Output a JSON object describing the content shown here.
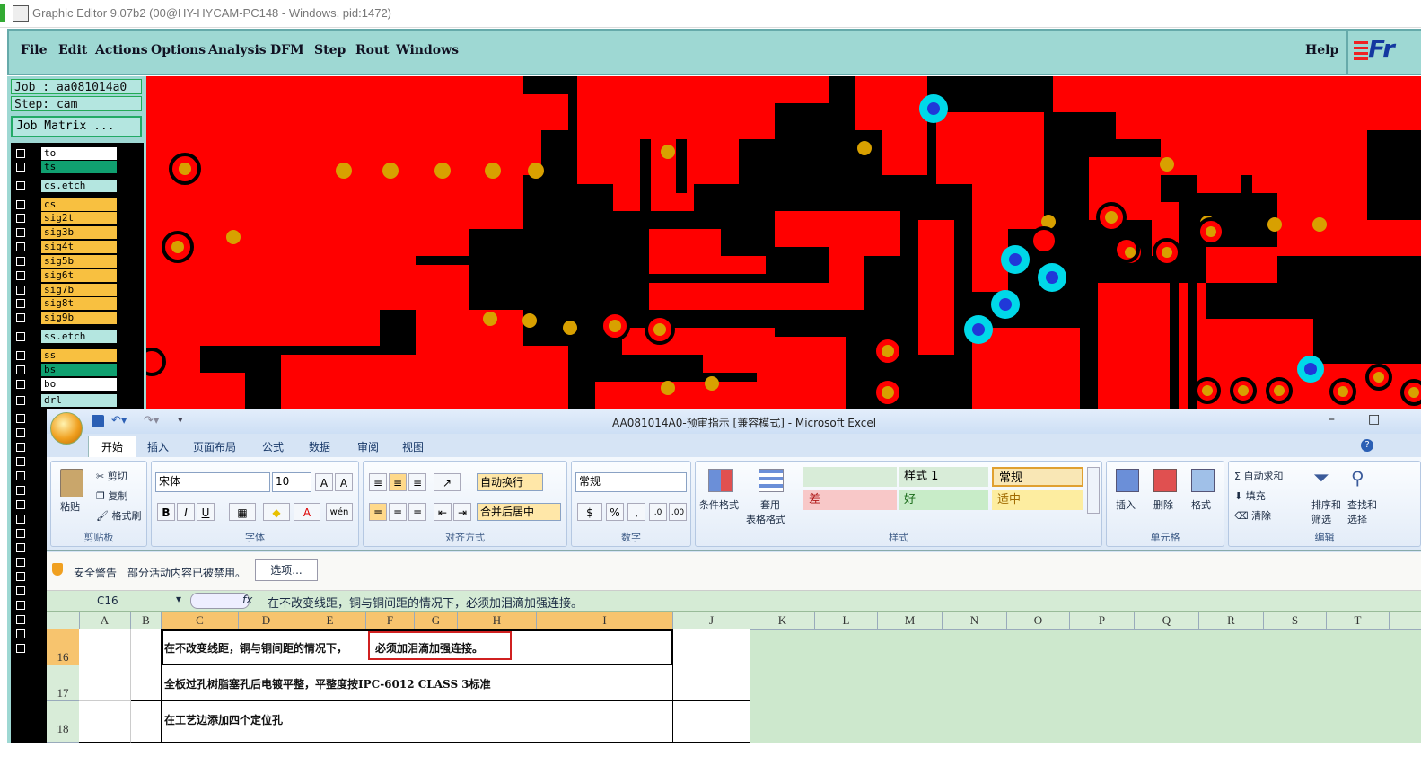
{
  "window": {
    "title": "Graphic Editor 9.07b2 (00@HY-HYCAM-PC148 - Windows, pid:1472)"
  },
  "menu": {
    "items": [
      "File",
      "Edit",
      "Actions",
      "Options",
      "Analysis",
      "DFM",
      "Step",
      "Rout",
      "Windows"
    ],
    "help": "Help",
    "logo": "Fr"
  },
  "panel": {
    "job": "Job : aa081014a0",
    "step": "Step: cam",
    "job_matrix": "Job Matrix ...",
    "layers": [
      {
        "name": "to",
        "color": "#ffffff"
      },
      {
        "name": "ts",
        "color": "#10a070"
      },
      {
        "name": "cs.etch",
        "color": "#b4e6e0"
      },
      {
        "name": "cs",
        "color": "#f8c040"
      },
      {
        "name": "sig2t",
        "color": "#f8c040"
      },
      {
        "name": "sig3b",
        "color": "#f8c040"
      },
      {
        "name": "sig4t",
        "color": "#f8c040"
      },
      {
        "name": "sig5b",
        "color": "#f8c040"
      },
      {
        "name": "sig6t",
        "color": "#f8c040"
      },
      {
        "name": "sig7b",
        "color": "#f8c040"
      },
      {
        "name": "sig8t",
        "color": "#f8c040"
      },
      {
        "name": "sig9b",
        "color": "#f8c040"
      },
      {
        "name": "ss.etch",
        "color": "#b4e6e0"
      },
      {
        "name": "ss",
        "color": "#f8c040"
      },
      {
        "name": "bs",
        "color": "#10a070"
      },
      {
        "name": "bo",
        "color": "#ffffff"
      },
      {
        "name": "drl",
        "color": "#b4e6e0"
      }
    ]
  },
  "excel": {
    "title": "AA081014A0-预审指示  [兼容模式] - Microsoft Excel",
    "tabs": [
      "开始",
      "插入",
      "页面布局",
      "公式",
      "数据",
      "审阅",
      "视图"
    ],
    "clipboard": {
      "paste": "粘贴",
      "cut": "剪切",
      "copy": "复制",
      "format_painter": "格式刷",
      "label": "剪贴板"
    },
    "font": {
      "name": "宋体",
      "size": "10",
      "label": "字体"
    },
    "alignment": {
      "wrap": "自动换行",
      "merge": "合并后居中",
      "label": "对齐方式"
    },
    "number": {
      "format": "常规",
      "label": "数字"
    },
    "styles": {
      "cond_format": "条件格式",
      "table_format_1": "套用",
      "table_format_2": "表格格式",
      "style1": "样式 1",
      "normal": "常规",
      "bad": "差",
      "good": "好",
      "neutral": "适中",
      "label": "样式"
    },
    "cells_group": {
      "insert": "插入",
      "delete": "删除",
      "format": "格式",
      "label": "单元格"
    },
    "editing": {
      "autosum": "自动求和",
      "fill": "填充",
      "clear": "清除",
      "sort_1": "排序和",
      "sort_2": "筛选",
      "find_1": "查找和",
      "find_2": "选择",
      "label": "编辑"
    },
    "security": {
      "label": "安全警告",
      "message": "部分活动内容已被禁用。",
      "options": "选项..."
    },
    "formula": {
      "cell_ref": "C16",
      "fx": "fx",
      "content": "在不改变线距，铜与铜间距的情况下，必须加泪滴加强连接。"
    },
    "columns": [
      "A",
      "B",
      "C",
      "D",
      "E",
      "F",
      "G",
      "H",
      "I",
      "J",
      "K",
      "L",
      "M",
      "N",
      "O",
      "P",
      "Q",
      "R",
      "S",
      "T"
    ],
    "rows": [
      {
        "num": "16",
        "text_a": "在不改变线距，铜与铜间距的情况下，",
        "text_b": "必须加泪滴加强连接。"
      },
      {
        "num": "17",
        "text": "全板过孔树脂塞孔后电镀平整，平整度按IPC-6012 CLASS 3标准"
      },
      {
        "num": "18",
        "text": "在工艺边添加四个定位孔"
      }
    ]
  }
}
